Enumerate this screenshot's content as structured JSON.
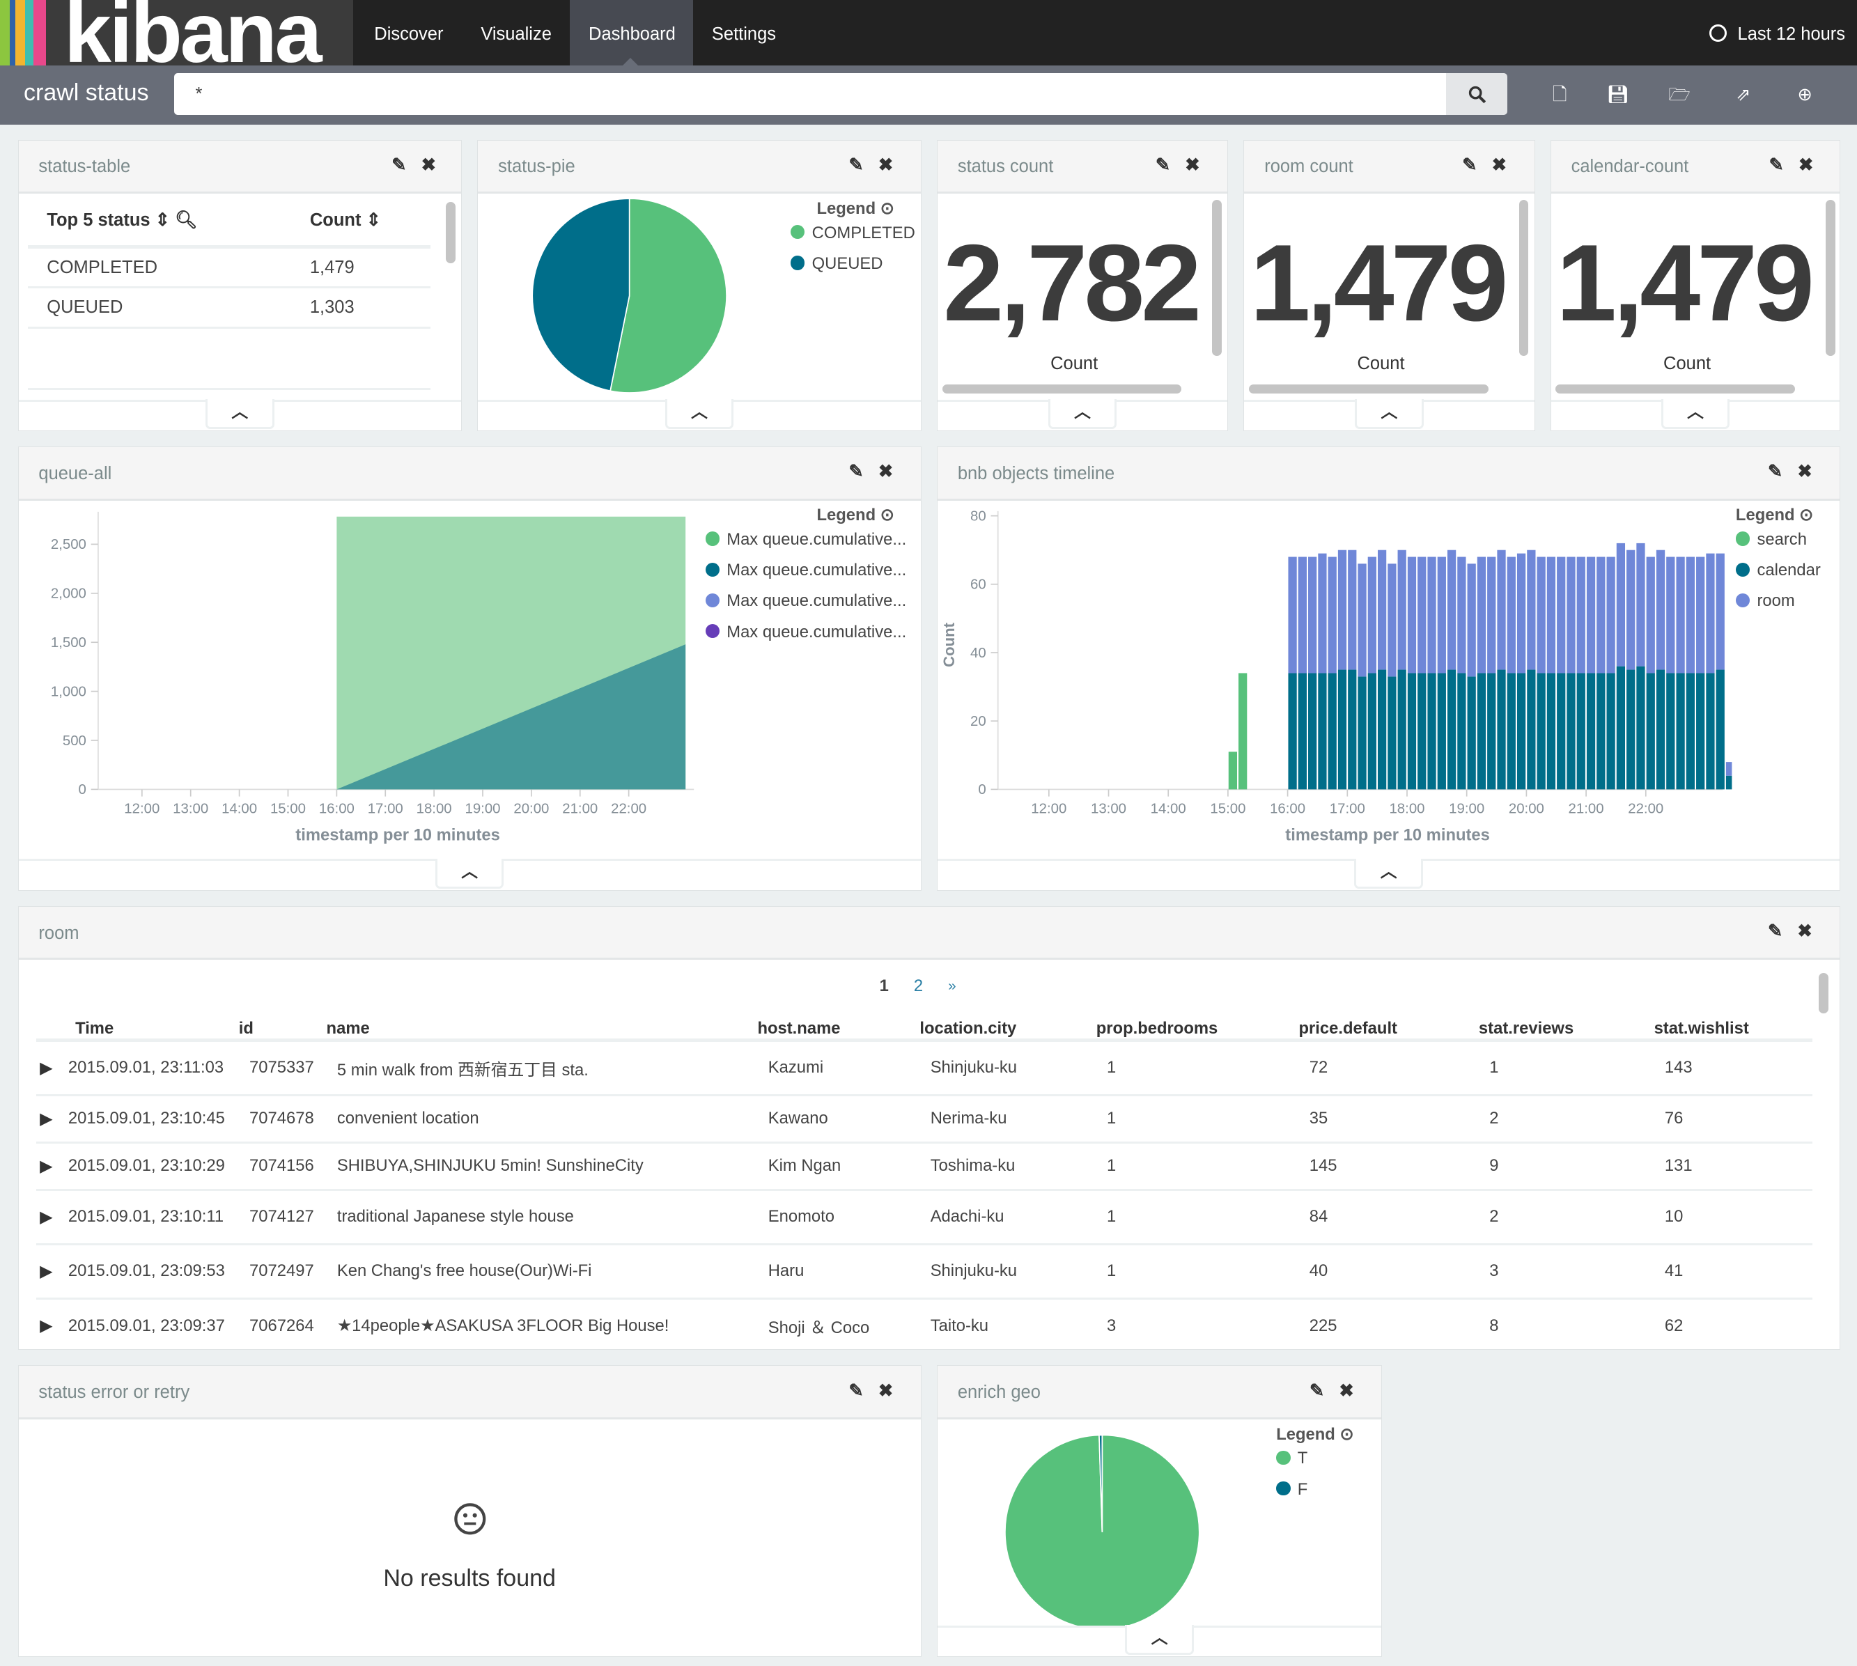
{
  "app": {
    "logo": "kibana",
    "stripe_colors": [
      "#8cc63f",
      "#2f63a8",
      "#f2b530",
      "#3ebeb0",
      "#e8488b"
    ]
  },
  "nav": {
    "items": [
      {
        "label": "Discover"
      },
      {
        "label": "Visualize"
      },
      {
        "label": "Dashboard",
        "active": true
      },
      {
        "label": "Settings"
      }
    ],
    "time": "Last 12 hours",
    "time_icon": "clock-icon"
  },
  "toolbar": {
    "dashboard_title": "crawl status",
    "query": "*",
    "icons": [
      "new-dashboard-icon",
      "save-icon",
      "open-icon",
      "share-icon",
      "add-panel-icon"
    ]
  },
  "colors": {
    "green": "#57c17b",
    "teal": "#006e8a",
    "blue": "#6f87d8",
    "purple": "#663db8"
  },
  "panels": {
    "status_table": {
      "title": "status-table",
      "columns": [
        "Top 5 status",
        "Count"
      ],
      "rows": [
        [
          "COMPLETED",
          "1,479"
        ],
        [
          "QUEUED",
          "1,303"
        ]
      ]
    },
    "status_pie": {
      "title": "status-pie",
      "legend_title": "Legend"
    },
    "status_count": {
      "title": "status count",
      "value": "2,782",
      "label": "Count"
    },
    "room_count": {
      "title": "room count",
      "value": "1,479",
      "label": "Count"
    },
    "calendar_count": {
      "title": "calendar-count",
      "value": "1,479",
      "label": "Count"
    },
    "queue_all": {
      "title": "queue-all",
      "legend_title": "Legend"
    },
    "bnb_timeline": {
      "title": "bnb objects timeline",
      "legend_title": "Legend"
    },
    "room": {
      "title": "room",
      "pages": [
        "1",
        "2",
        "»"
      ],
      "columns": [
        "Time",
        "id",
        "name",
        "host.name",
        "location.city",
        "prop.bedrooms",
        "price.default",
        "stat.reviews",
        "stat.wishlist"
      ],
      "rows": [
        [
          "2015.09.01, 23:11:03",
          "7075337",
          "5 min walk from 西新宿五丁目 sta.",
          "Kazumi",
          "Shinjuku-ku",
          "1",
          "72",
          "1",
          "143"
        ],
        [
          "2015.09.01, 23:10:45",
          "7074678",
          "convenient location",
          "Kawano",
          "Nerima-ku",
          "1",
          "35",
          "2",
          "76"
        ],
        [
          "2015.09.01, 23:10:29",
          "7074156",
          "SHIBUYA,SHINJUKU 5min! SunshineCity",
          "Kim Ngan",
          "Toshima-ku",
          "1",
          "145",
          "9",
          "131"
        ],
        [
          "2015.09.01, 23:10:11",
          "7074127",
          "traditional Japanese style house",
          "Enomoto",
          "Adachi-ku",
          "1",
          "84",
          "2",
          "10"
        ],
        [
          "2015.09.01, 23:09:53",
          "7072497",
          "Ken Chang's free house(Our)Wi-Fi",
          "Haru",
          "Shinjuku-ku",
          "1",
          "40",
          "3",
          "41"
        ],
        [
          "2015.09.01, 23:09:37",
          "7067264",
          "★14people★ASAKUSA 3FLOOR Big House!",
          "Shoji ＆ Coco",
          "Taito-ku",
          "3",
          "225",
          "8",
          "62"
        ]
      ]
    },
    "status_error": {
      "title": "status error or retry",
      "message": "No results found",
      "icon": "meh-face-icon"
    },
    "enrich_geo": {
      "title": "enrich geo",
      "legend_title": "Legend"
    }
  },
  "chart_data": [
    {
      "id": "status-pie",
      "type": "pie",
      "slices": [
        {
          "name": "COMPLETED",
          "value": 1479,
          "color": "#57c17b"
        },
        {
          "name": "QUEUED",
          "value": 1303,
          "color": "#006e8a"
        }
      ],
      "legend": "top-right"
    },
    {
      "id": "queue-all",
      "type": "area",
      "xlabel": "timestamp per 10 minutes",
      "ylabel": "",
      "ylim": [
        0,
        2782
      ],
      "xlim": [
        "11:06",
        "23:15"
      ],
      "xticks": [
        "12:00",
        "13:00",
        "14:00",
        "15:00",
        "16:00",
        "17:00",
        "18:00",
        "19:00",
        "20:00",
        "21:00",
        "22:00"
      ],
      "yticks": [
        0,
        500,
        1000,
        1500,
        2000,
        2500
      ],
      "ytick_labels": [
        "0",
        "500",
        "1,000",
        "1,500",
        "2,000",
        "2,500"
      ],
      "series": [
        {
          "name": "Max queue.cumulative...",
          "color": "#57c17b",
          "points": [
            [
              "16:00",
              2782
            ],
            [
              "23:10",
              2782
            ]
          ]
        },
        {
          "name": "Max queue.cumulative...",
          "color": "#006e8a",
          "points": [
            [
              "16:00",
              0
            ],
            [
              "23:10",
              1479
            ]
          ]
        },
        {
          "name": "Max queue.cumulative...",
          "color": "#6f87d8",
          "points": []
        },
        {
          "name": "Max queue.cumulative...",
          "color": "#663db8",
          "points": []
        }
      ],
      "legend": "right"
    },
    {
      "id": "bnb-objects-timeline",
      "type": "bar",
      "stacked": true,
      "xlabel": "timestamp per 10 minutes",
      "ylabel": "Count",
      "ylim": [
        0,
        80
      ],
      "xlim": [
        "11:08",
        "23:30"
      ],
      "xticks": [
        "12:00",
        "13:00",
        "14:00",
        "15:00",
        "16:00",
        "17:00",
        "18:00",
        "19:00",
        "20:00",
        "21:00",
        "22:00"
      ],
      "yticks": [
        0,
        20,
        40,
        60,
        80
      ],
      "x": [
        "15:00",
        "15:10",
        "16:00",
        "16:10",
        "16:20",
        "16:30",
        "16:40",
        "16:50",
        "17:00",
        "17:10",
        "17:20",
        "17:30",
        "17:40",
        "17:50",
        "18:00",
        "18:10",
        "18:20",
        "18:30",
        "18:40",
        "18:50",
        "19:00",
        "19:10",
        "19:20",
        "19:30",
        "19:40",
        "19:50",
        "20:00",
        "20:10",
        "20:20",
        "20:30",
        "20:40",
        "20:50",
        "21:00",
        "21:10",
        "21:20",
        "21:30",
        "21:40",
        "21:50",
        "22:00",
        "22:10",
        "22:20",
        "22:30",
        "22:40",
        "22:50",
        "23:00",
        "23:10",
        "23:20"
      ],
      "series": [
        {
          "name": "search",
          "color": "#57c17b",
          "values": [
            11,
            34,
            0,
            0,
            0,
            0,
            0,
            0,
            0,
            0,
            0,
            0,
            0,
            0,
            0,
            0,
            0,
            0,
            0,
            0,
            0,
            0,
            0,
            0,
            0,
            0,
            0,
            0,
            0,
            0,
            0,
            0,
            0,
            0,
            0,
            0,
            0,
            0,
            0,
            0,
            0,
            0,
            0,
            0,
            0,
            0,
            0
          ]
        },
        {
          "name": "calendar",
          "color": "#006e8a",
          "values": [
            0,
            0,
            34,
            34,
            34,
            34,
            34,
            35,
            35,
            33,
            34,
            35,
            33,
            35,
            34,
            34,
            34,
            34,
            35,
            34,
            33,
            34,
            34,
            35,
            34,
            34,
            35,
            34,
            34,
            34,
            34,
            34,
            34,
            34,
            34,
            36,
            35,
            36,
            34,
            35,
            34,
            34,
            34,
            34,
            34,
            35,
            4
          ]
        },
        {
          "name": "room",
          "color": "#6f87d8",
          "values": [
            0,
            0,
            34,
            34,
            34,
            35,
            34,
            35,
            35,
            33,
            34,
            35,
            33,
            35,
            34,
            34,
            34,
            34,
            35,
            34,
            33,
            34,
            34,
            35,
            34,
            35,
            35,
            34,
            34,
            34,
            34,
            34,
            34,
            34,
            34,
            36,
            35,
            36,
            34,
            35,
            34,
            34,
            34,
            34,
            35,
            34,
            4
          ]
        }
      ],
      "legend": "right"
    },
    {
      "id": "enrich-geo",
      "type": "pie",
      "slices": [
        {
          "name": "T",
          "value": 99.5,
          "color": "#57c17b"
        },
        {
          "name": "F",
          "value": 0.5,
          "color": "#006e8a"
        }
      ],
      "legend": "top-right"
    }
  ]
}
